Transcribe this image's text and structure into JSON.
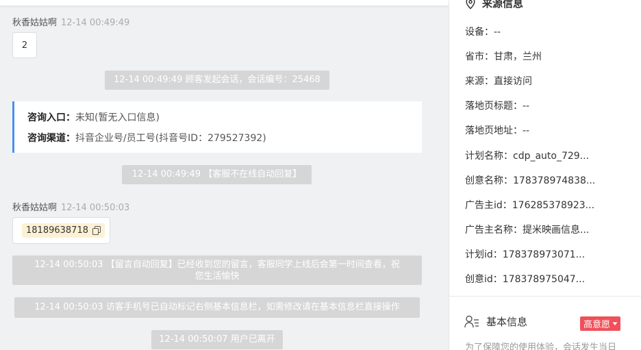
{
  "chat": {
    "messages": {
      "m1": {
        "sender": "秋香姑姑啊",
        "time": "12-14 00:49:49",
        "text": "2"
      },
      "sys1": "12-14 00:49:49 顾客发起会话，会话编号：25468",
      "entry": {
        "label1": "咨询入口：",
        "value1": "未知(暂无入口信息)",
        "label2": "咨询渠道：",
        "value2": "抖音企业号/员工号(抖音号ID：279527392)"
      },
      "sys2": "12-14 00:49:49 【客服不在线自动回复】",
      "m2": {
        "sender": "秋香姑姑啊",
        "time": "12-14 00:50:03",
        "phone": "18189638718"
      },
      "sys3_line1": "12-14 00:50:03 【留言自动回复】已经收到您的留言，客服同学上线后会第一时间查看，祝",
      "sys3_line2": "您生活愉快",
      "sys4": "12-14 00:50:03 访客手机号已自动标记右侧基本信息栏，如需修改请在基本信息栏直接操作",
      "sys5": "12-14 00:50:07 用户已离开"
    }
  },
  "panel": {
    "source_title": "来源信息",
    "source_icon": "location-pin-icon",
    "rows": [
      "设备：--",
      "省市：甘肃，兰州",
      "来源：直接访问",
      "落地页标题：--",
      "落地页地址：--",
      "计划名称：cdp_auto_729...",
      "创意名称：178378974838...",
      "广告主id：176285378923...",
      "广告主名称：提米映画信息...",
      "计划id：178378973071...",
      "创意id：178378975047..."
    ],
    "basic_title": "基本信息",
    "basic_icon": "user-list-icon",
    "intent_badge": "高意愿",
    "basic_note": "为了保障您的使用体验，会话发生当日"
  }
}
